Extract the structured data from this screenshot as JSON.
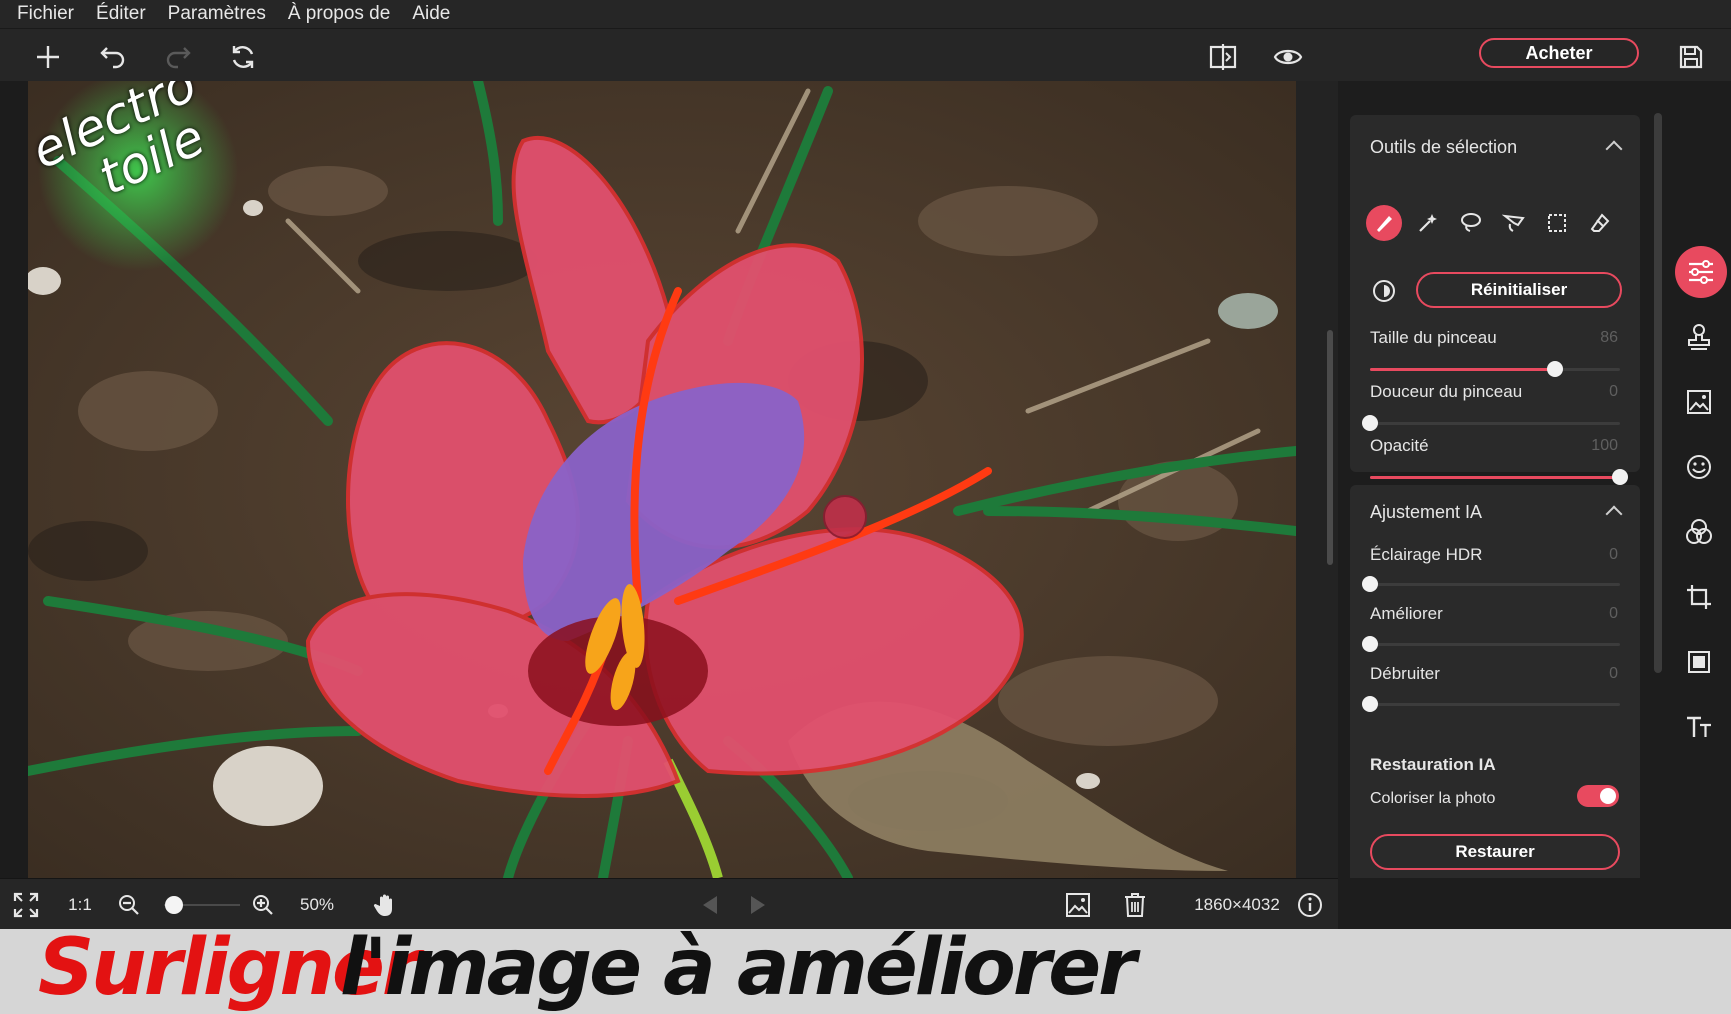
{
  "menu": [
    "Fichier",
    "Éditer",
    "Paramètres",
    "À propos de",
    "Aide"
  ],
  "toolbar": {
    "buy_label": "Acheter",
    "icons": [
      "plus-icon",
      "undo-icon",
      "redo-icon",
      "refresh-icon",
      "compare-icon",
      "eye-icon",
      "save-icon"
    ]
  },
  "canvas": {
    "watermark_line1": "electro",
    "watermark_line2": "toile"
  },
  "selection_tools": {
    "title": "Outils de sélection",
    "reset_label": "Réinitialiser",
    "tools": [
      "brush-icon",
      "magic-wand-icon",
      "lasso-icon",
      "polygon-lasso-icon",
      "rect-select-icon",
      "eraser-icon"
    ],
    "brush_size": {
      "label": "Taille du pinceau",
      "value": 86,
      "fraction": 0.74
    },
    "brush_softness": {
      "label": "Douceur du pinceau",
      "value": 0,
      "fraction": 0
    },
    "opacity": {
      "label": "Opacité",
      "value": 100,
      "fraction": 1
    }
  },
  "ai_adjust": {
    "title": "Ajustement IA",
    "hdr": {
      "label": "Éclairage HDR",
      "value": 0,
      "fraction": 0
    },
    "enhance": {
      "label": "Améliorer",
      "value": 0,
      "fraction": 0
    },
    "denoise": {
      "label": "Débruiter",
      "value": 0,
      "fraction": 0
    }
  },
  "ai_restore": {
    "title": "Restauration IA",
    "colorize_label": "Coloriser la photo",
    "colorize_on": true,
    "restore_label": "Restaurer"
  },
  "rail_icons": [
    "adjust-sliders-icon",
    "stamp-icon",
    "image-icon",
    "face-icon",
    "color-blend-icon",
    "crop-icon",
    "transform-icon",
    "text-icon"
  ],
  "bottom": {
    "fit_icon": "fit-screen-icon",
    "one_to_one": "1:1",
    "zoom_fraction": 0.1,
    "zoom": "50%",
    "dimensions": "1860×4032"
  },
  "caption": {
    "highlight": "Surligner",
    "rest": "l'image à améliorer"
  },
  "colors": {
    "accent": "#e84a5f",
    "panel": "#2a2a2a",
    "background": "#1f1f1f"
  }
}
